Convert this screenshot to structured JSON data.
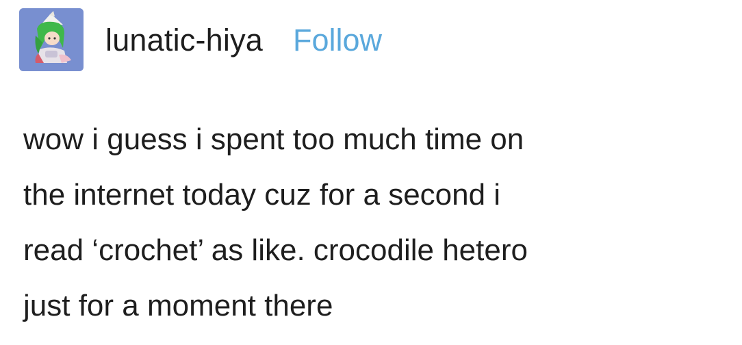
{
  "post": {
    "username": "lunatic-hiya",
    "follow_label": "Follow",
    "avatar_icon": "anime-girl-avatar-icon",
    "body_lines": [
      "wow i guess i spent too much time on",
      "the internet today cuz for a second i",
      "read ‘crochet’ as like. crocodile hetero",
      "just for a moment there"
    ]
  },
  "colors": {
    "follow_link": "#5aa8dc",
    "text": "#1e1e1e",
    "avatar_bg": "#6f86c9"
  }
}
